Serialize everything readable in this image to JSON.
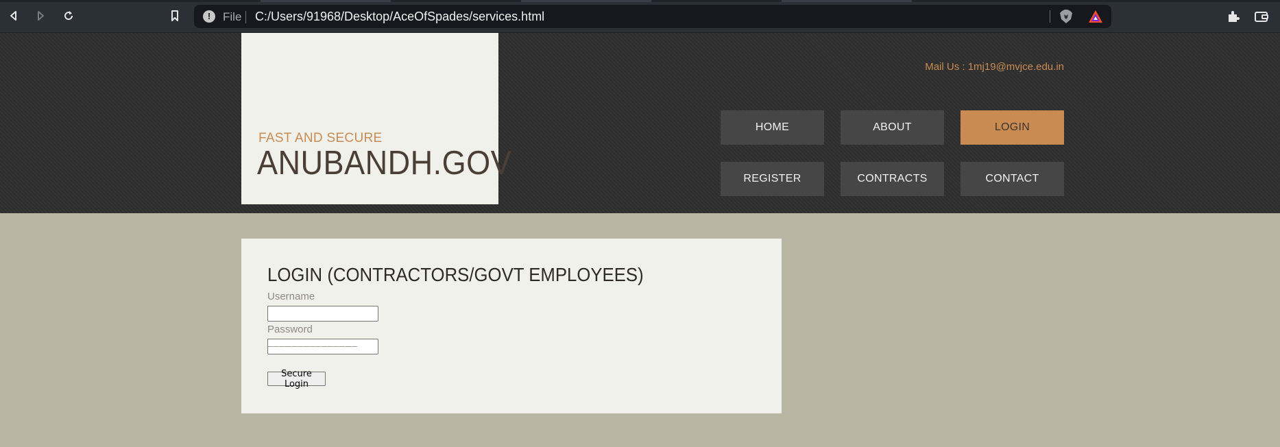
{
  "browser": {
    "file_label": "File",
    "url": "C:/Users/91968/Desktop/AceOfSpades/services.html"
  },
  "site": {
    "tagline": "FAST AND SECURE",
    "title": "ANUBANDH.GOV",
    "mail": "Mail Us : 1mj19@mvjce.edu.in",
    "nav": [
      {
        "label": "HOME",
        "active": false
      },
      {
        "label": "ABOUT",
        "active": false
      },
      {
        "label": "LOGIN",
        "active": true
      },
      {
        "label": "REGISTER",
        "active": false
      },
      {
        "label": "CONTRACTS",
        "active": false
      },
      {
        "label": "CONTACT",
        "active": false
      }
    ],
    "accent_color": "#c98b52"
  },
  "login": {
    "heading": "LOGIN (CONTRACTORS/GOVT EMPLOYEES)",
    "username_label": "Username",
    "username_value": "",
    "password_label": "Password",
    "password_value": "",
    "divider": "_______________",
    "submit_label": "Secure Login"
  }
}
